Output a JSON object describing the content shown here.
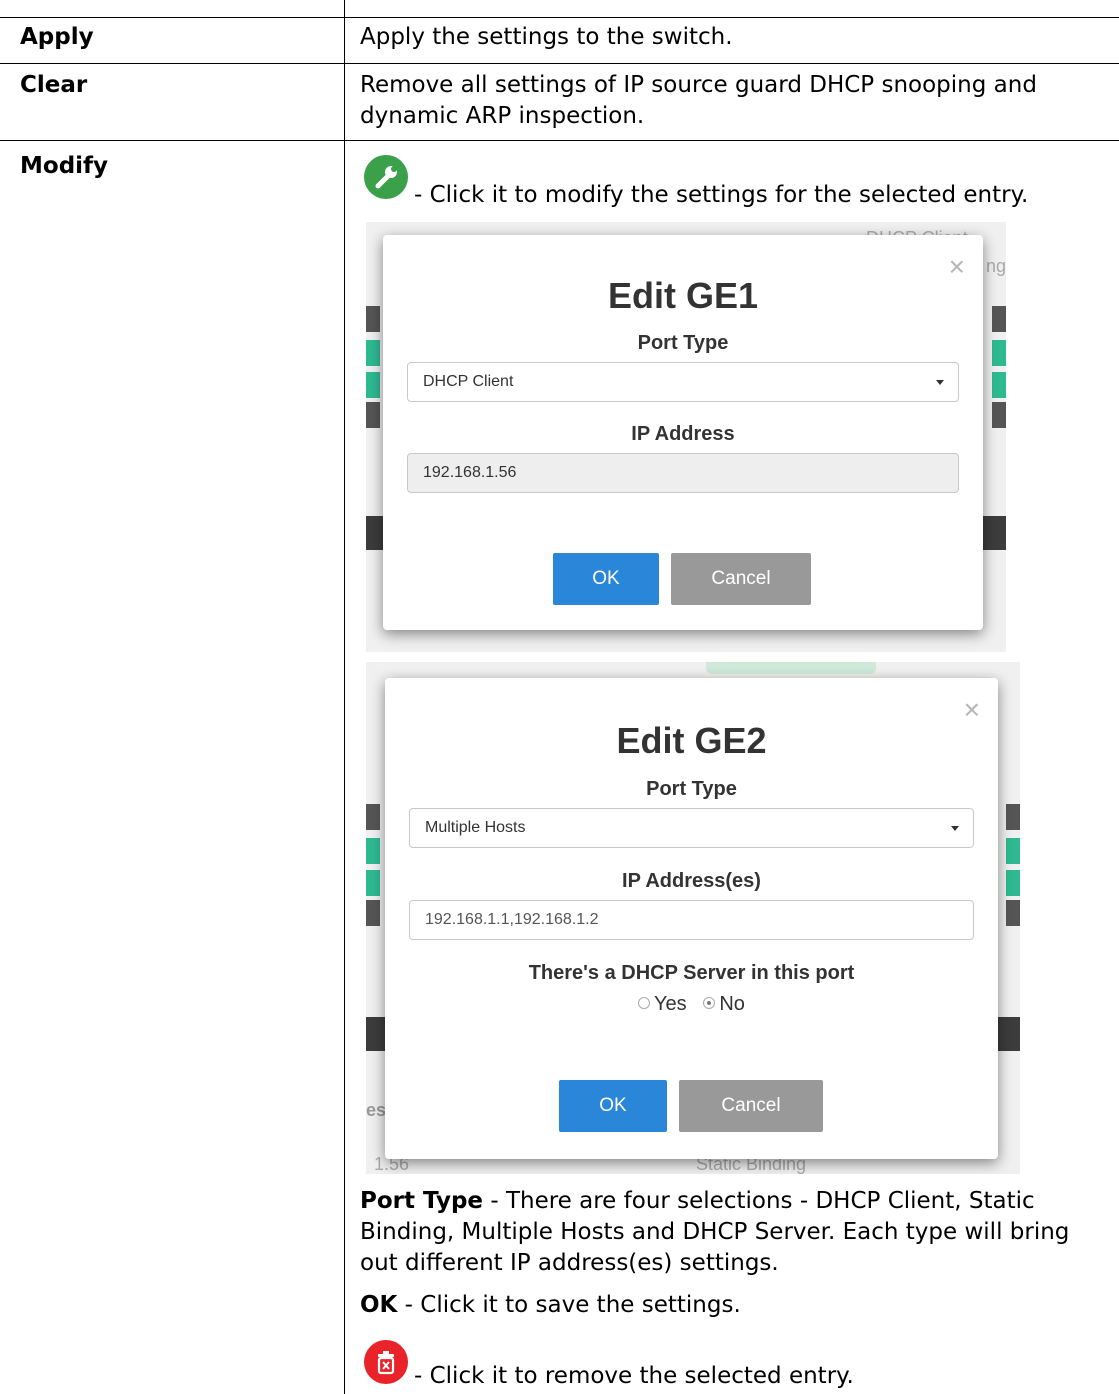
{
  "rows": {
    "apply": {
      "label": "Apply",
      "desc": "Apply the settings to the switch."
    },
    "clear": {
      "label": "Clear",
      "desc_line1": "Remove all settings of IP source guard DHCP snooping and",
      "desc_line2": "dynamic ARP inspection."
    },
    "modify": {
      "label": "Modify",
      "modify_hint": "- Click it to modify the settings for the selected entry.",
      "port_type_term": "Port Type",
      "port_type_desc_1": " - There are four selections - DHCP Client, Static",
      "port_type_desc_2": "Binding, Multiple Hosts and DHCP Server. Each type will bring",
      "port_type_desc_3": "out different IP address(es) settings.",
      "ok_term": "OK",
      "ok_desc": " - Click it to save the settings.",
      "delete_hint": "- Click it to remove the selected entry."
    }
  },
  "dialog_ge1": {
    "title": "Edit GE1",
    "port_type_label": "Port Type",
    "port_type_value": "DHCP Client",
    "ip_label": "IP Address",
    "ip_value": "192.168.1.56",
    "ok": "OK",
    "cancel": "Cancel",
    "close": "×",
    "bg_text_1": "DHCP Client",
    "bg_text_2": "ng"
  },
  "dialog_ge2": {
    "title": "Edit GE2",
    "port_type_label": "Port Type",
    "port_type_value": "Multiple Hosts",
    "ip_label": "IP Address(es)",
    "ip_value": "192.168.1.1,192.168.1.2",
    "dhcp_question": "There's a DHCP Server in this port",
    "radio_yes": "Yes",
    "radio_no": "No",
    "radio_selected": "No",
    "ok": "OK",
    "cancel": "Cancel",
    "close": "×",
    "bg_text_left": "es",
    "bg_text_ip": "1.56",
    "bg_text_static": "Static Binding"
  },
  "colors": {
    "modify_icon": "#3aa04a",
    "delete_icon": "#e8232a",
    "ok_button": "#2a86d8",
    "cancel_button": "#999999",
    "teal_row": "#2fb991"
  },
  "icons": {
    "modify": "wrench-icon",
    "delete": "trash-icon"
  }
}
